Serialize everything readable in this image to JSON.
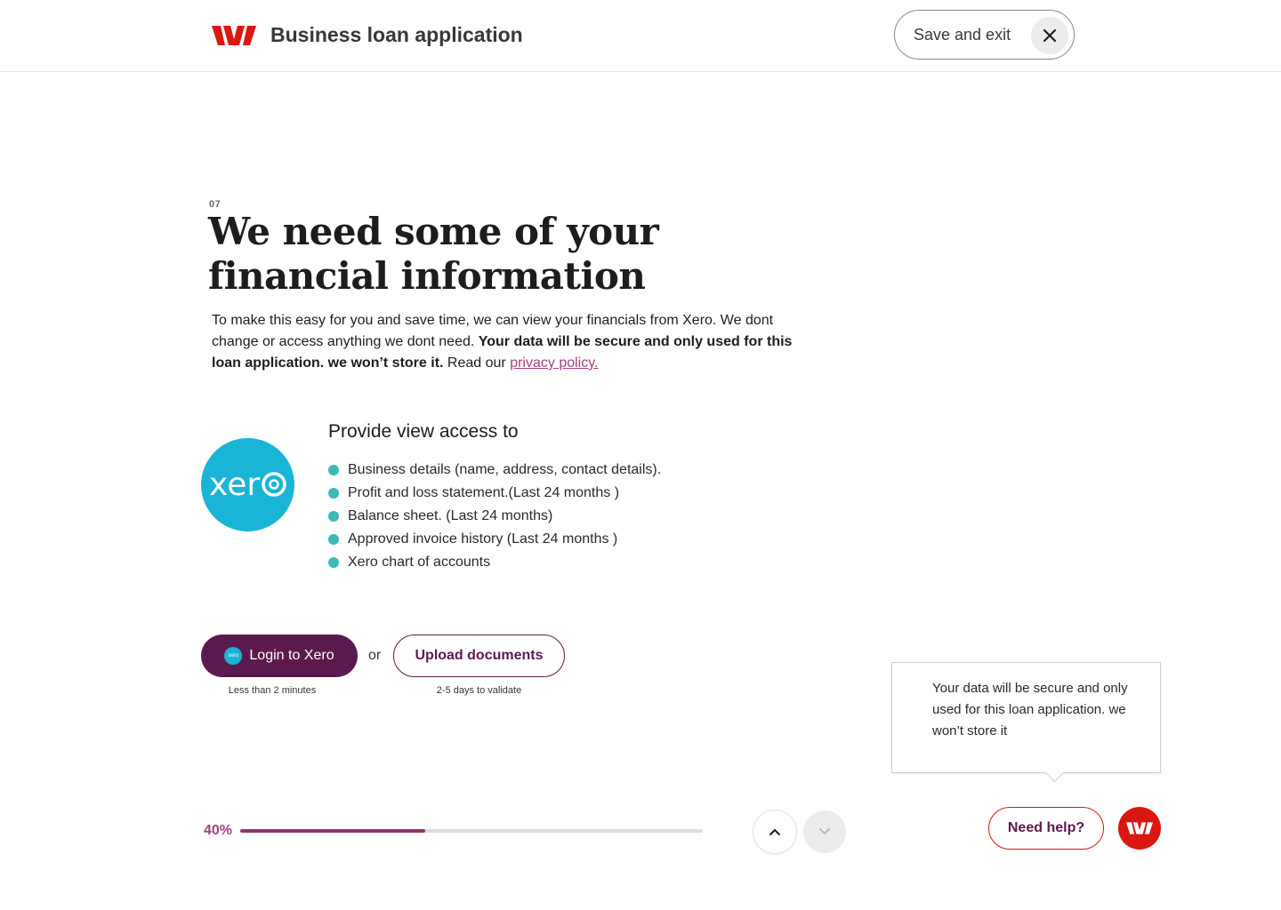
{
  "brand": {
    "app_title": "Business loan application",
    "accent_color": "#da1710",
    "primary_color": "#5b1a4e",
    "link_color": "#a3407f",
    "xero_color": "#1ab4d7"
  },
  "header": {
    "save_exit_label": "Save and exit",
    "close_icon": "close-icon"
  },
  "step": {
    "number": "07",
    "title": "We need some of your financial information",
    "intro_plain": "To make this easy for you and save time, we can view your financials from Xero.  We dont change or access anything we dont need. ",
    "intro_bold": "Your data will be secure and only used for this loan application. we won’t store it.",
    "intro_read": " Read our ",
    "privacy_link": "privacy policy."
  },
  "access": {
    "logo_text": "xero",
    "title": "Provide view access to",
    "items": [
      "Business details (name, address, contact details).",
      "Profit and loss statement.(Last 24 months )",
      "Balance sheet. (Last 24 months)",
      "Approved invoice history (Last 24 months )",
      "Xero chart of accounts"
    ]
  },
  "actions": {
    "login_label": "Login to Xero",
    "login_icon_text": "xero",
    "login_hint": "Less than 2 minutes",
    "or_label": "or",
    "upload_label": "Upload documents",
    "upload_hint": "2-5 days to validate"
  },
  "tooltip": {
    "text": "Your data will be secure and only used for this loan application. we won’t store it"
  },
  "progress": {
    "label": "40%",
    "value": 0.4
  },
  "nav": {
    "up_icon": "chevron-up-icon",
    "down_icon": "chevron-down-icon"
  },
  "help": {
    "label": "Need help?"
  }
}
